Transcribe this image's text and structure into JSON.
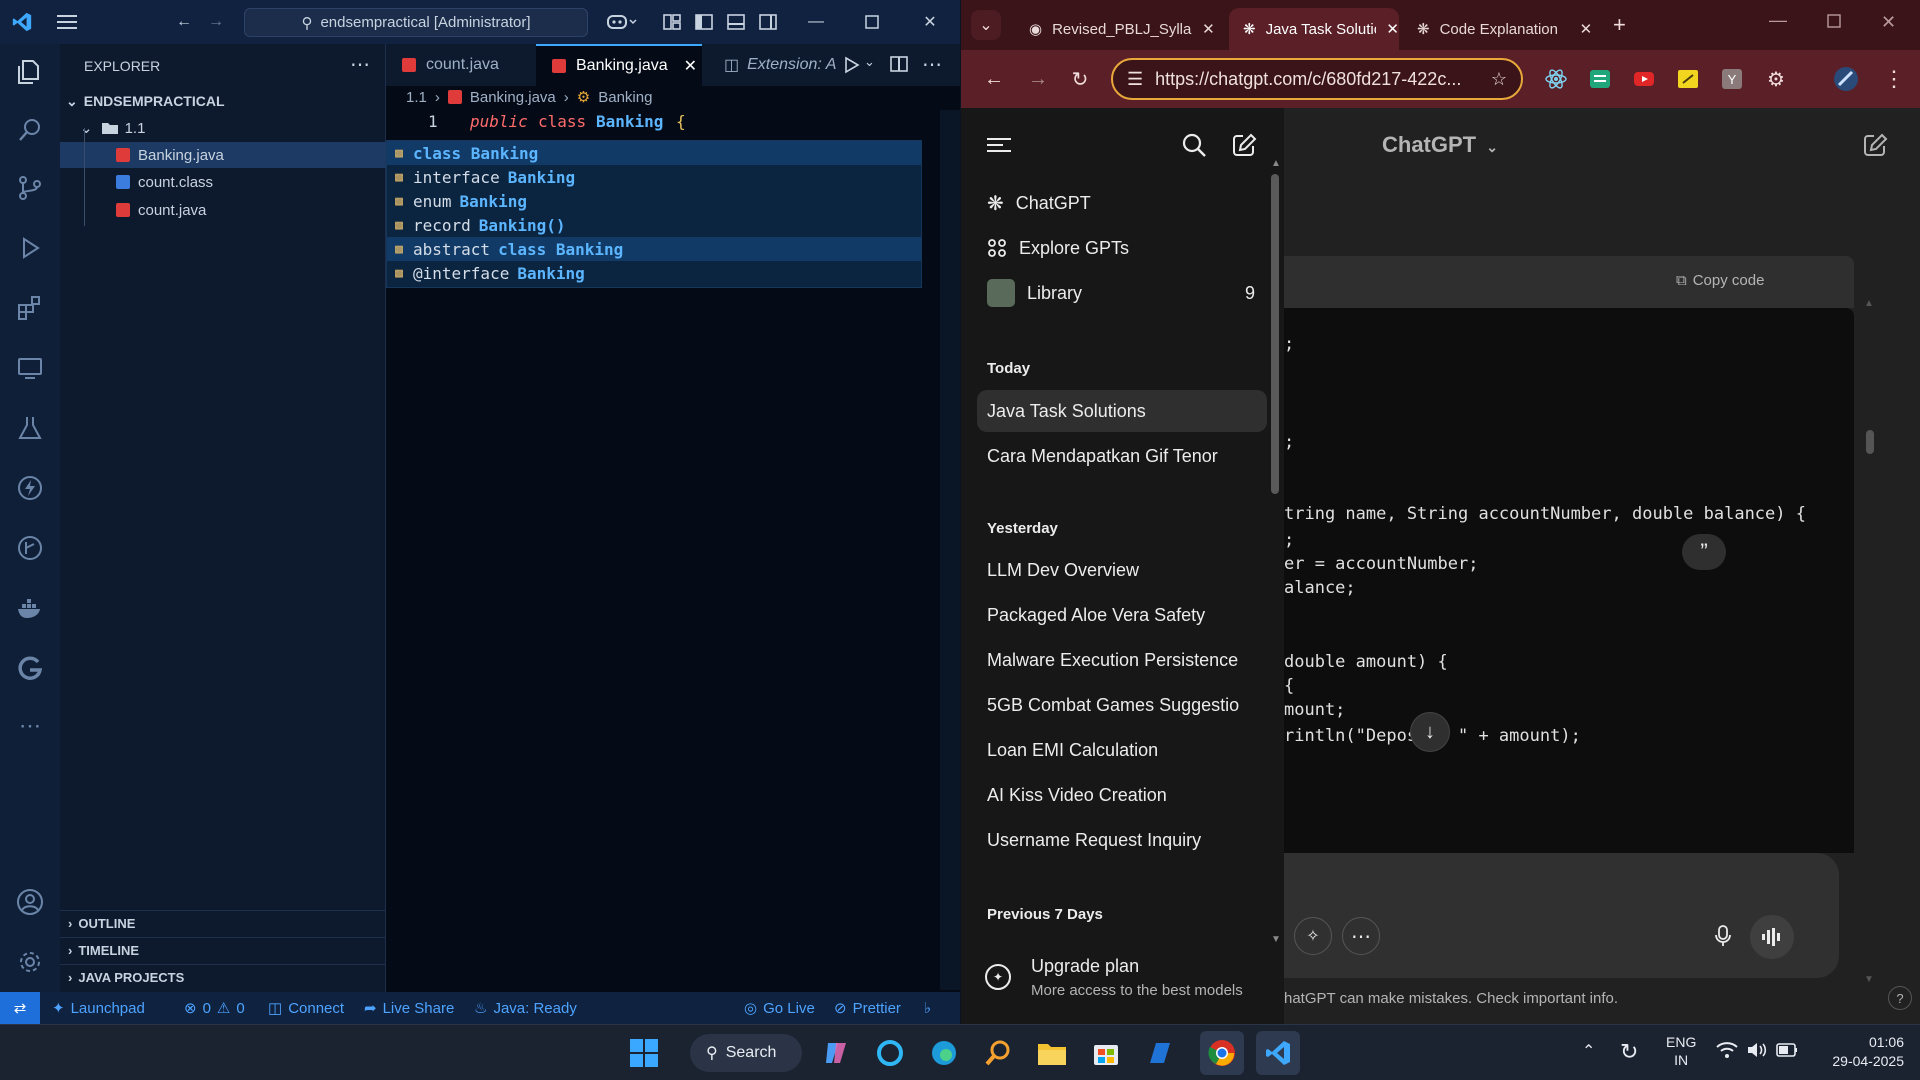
{
  "vscode": {
    "title_search": "endsempractical [Administrator]",
    "explorer_title": "EXPLORER",
    "root": "ENDSEMPRACTICAL",
    "folder": "1.1",
    "files": [
      "Banking.java",
      "count.class",
      "count.java"
    ],
    "sections": [
      "OUTLINE",
      "TIMELINE",
      "JAVA PROJECTS"
    ],
    "tabs": [
      "count.java",
      "Banking.java",
      "Extension: A"
    ],
    "breadcrumb": [
      "1.1",
      "Banking.java",
      "Banking"
    ],
    "code": {
      "line_number": "1",
      "public": "public",
      "class_kw": "class",
      "name": "Banking",
      "brace": "{"
    },
    "suggestions": [
      {
        "prefix": "",
        "text": "class Banking",
        "kw": ""
      },
      {
        "prefix": "interface",
        "text": "",
        "kw": "Banking"
      },
      {
        "prefix": "enum",
        "text": "",
        "kw": "Banking"
      },
      {
        "prefix": "record",
        "text": "",
        "kw": "Banking()"
      },
      {
        "prefix": "abstract",
        "text": "",
        "kw": "class Banking"
      },
      {
        "prefix": "@interface",
        "text": "",
        "kw": "Banking"
      }
    ],
    "status": {
      "launchpad": "Launchpad",
      "errors": "0",
      "warnings": "0",
      "connect": "Connect",
      "live_share": "Live Share",
      "java": "Java: Ready",
      "go_live": "Go Live",
      "prettier": "Prettier"
    }
  },
  "chrome": {
    "tabs": [
      "Revised_PBLJ_Sylla",
      "Java Task Solutions",
      "Code Explanation"
    ],
    "url": "https://chatgpt.com/c/680fd217-422c..."
  },
  "chatgpt": {
    "model": "ChatGPT",
    "nav": [
      "ChatGPT",
      "Explore GPTs",
      "Library"
    ],
    "library_count": "9",
    "today_label": "Today",
    "today": [
      "Java Task Solutions",
      "Cara Mendapatkan Gif Tenor"
    ],
    "yesterday_label": "Yesterday",
    "yesterday": [
      "LLM Dev Overview",
      "Packaged Aloe Vera Safety",
      "Malware Execution Persistence",
      "5GB Combat Games Suggestio",
      "Loan EMI Calculation",
      "AI Kiss Video Creation",
      "Username Request Inquiry"
    ],
    "prev_label": "Previous 7 Days",
    "upgrade_title": "Upgrade plan",
    "upgrade_sub": "More access to the best models",
    "copy_code": "Copy code",
    "code_lines": [
      ";",
      ";",
      "tring name, String accountNumber, double balance) {",
      ";",
      "er = accountNumber;",
      "alance;",
      "double amount) {",
      "{",
      "mount;",
      "rintln(\"Deposit: \" + amount);"
    ],
    "disclaimer": "hatGPT can make mistakes. Check important info."
  },
  "taskbar": {
    "search": "Search",
    "lang": "ENG",
    "region": "IN",
    "time": "01:06",
    "date": "29-04-2025"
  }
}
